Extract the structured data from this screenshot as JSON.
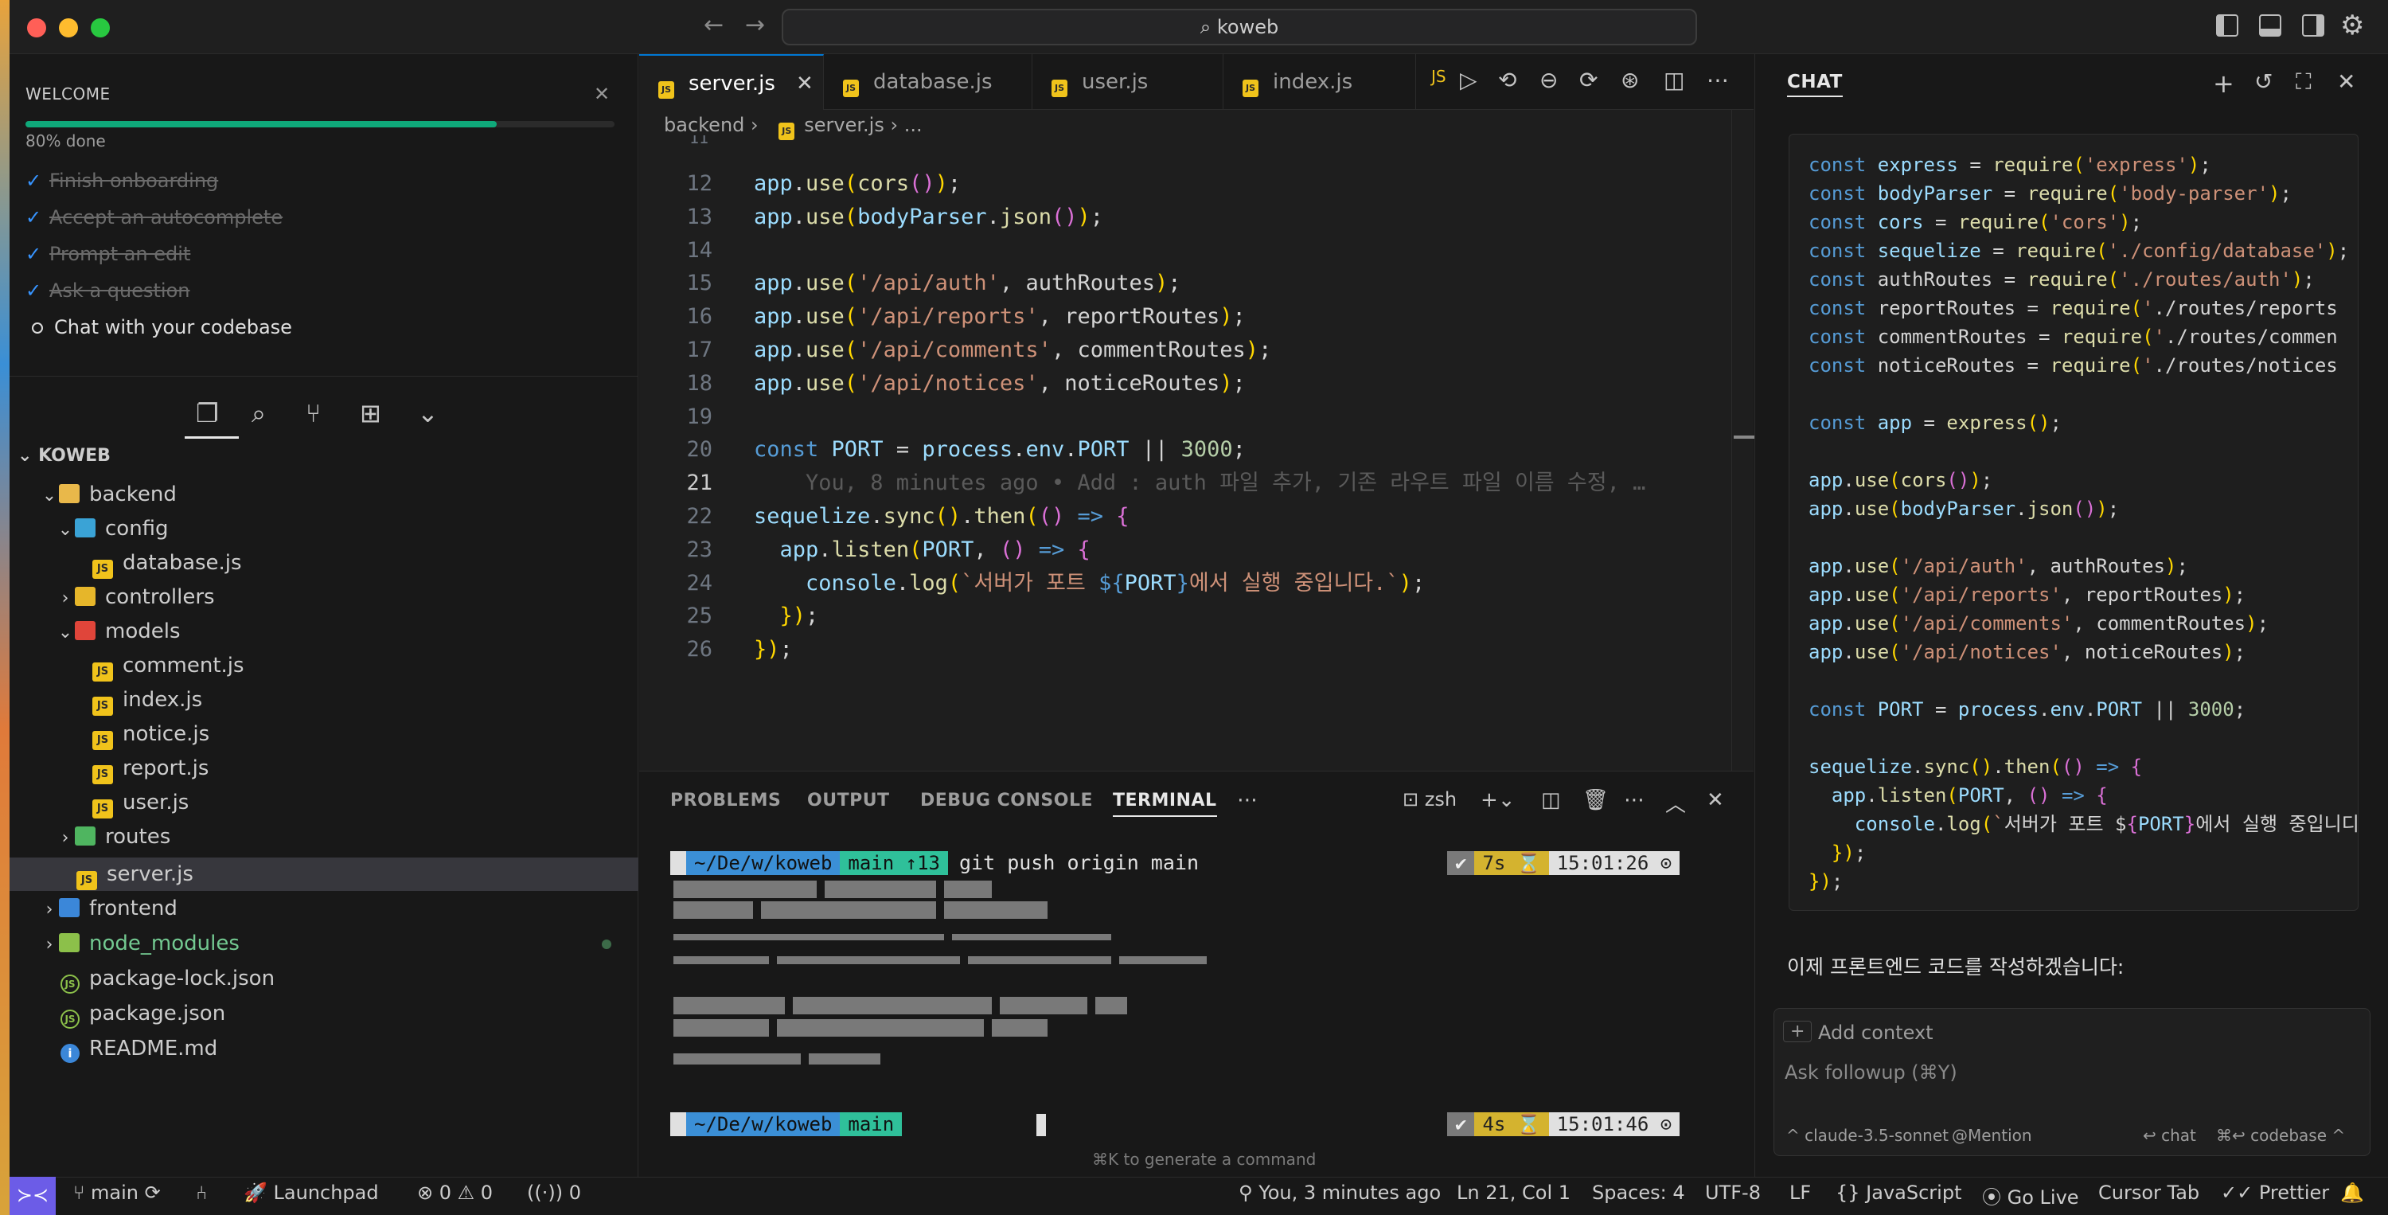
{
  "window": {
    "search_text": "koweb"
  },
  "onboarding": {
    "title": "WELCOME",
    "progress": 0.8,
    "progress_label": "80% done",
    "items": [
      {
        "label": "Finish onboarding",
        "done": true
      },
      {
        "label": "Accept an autocomplete",
        "done": true
      },
      {
        "label": "Prompt an edit",
        "done": true
      },
      {
        "label": "Ask a question",
        "done": true
      },
      {
        "label": "Chat with your codebase",
        "done": false
      }
    ]
  },
  "explorer": {
    "root": "KOWEB",
    "tree": [
      {
        "label": "backend",
        "type": "folder"
      },
      {
        "label": "config",
        "type": "folder"
      },
      {
        "label": "database.js",
        "type": "js"
      },
      {
        "label": "controllers",
        "type": "folder"
      },
      {
        "label": "models",
        "type": "folder"
      },
      {
        "label": "comment.js",
        "type": "js"
      },
      {
        "label": "index.js",
        "type": "js"
      },
      {
        "label": "notice.js",
        "type": "js"
      },
      {
        "label": "report.js",
        "type": "js"
      },
      {
        "label": "user.js",
        "type": "js"
      },
      {
        "label": "routes",
        "type": "folder"
      },
      {
        "label": "server.js",
        "type": "js",
        "selected": true
      },
      {
        "label": "frontend",
        "type": "folder"
      },
      {
        "label": "node_modules",
        "type": "folder"
      },
      {
        "label": "package-lock.json",
        "type": "json"
      },
      {
        "label": "package.json",
        "type": "json"
      },
      {
        "label": "README.md",
        "type": "info"
      }
    ]
  },
  "editor": {
    "tabs": [
      {
        "label": "server.js",
        "active": true
      },
      {
        "label": "database.js",
        "active": false
      },
      {
        "label": "user.js",
        "active": false
      },
      {
        "label": "index.js",
        "active": false
      }
    ],
    "breadcrumb": {
      "folder": "backend",
      "file": "server.js",
      "more": "..."
    },
    "top_line_stub": "11",
    "lines": [
      {
        "n": "12",
        "code": "app.use(cors());"
      },
      {
        "n": "13",
        "code": "app.use(bodyParser.json());"
      },
      {
        "n": "14",
        "code": ""
      },
      {
        "n": "15",
        "code": "app.use('/api/auth', authRoutes);"
      },
      {
        "n": "16",
        "code": "app.use('/api/reports', reportRoutes);"
      },
      {
        "n": "17",
        "code": "app.use('/api/comments', commentRoutes);"
      },
      {
        "n": "18",
        "code": "app.use('/api/notices', noticeRoutes);"
      },
      {
        "n": "19",
        "code": ""
      },
      {
        "n": "20",
        "code": "const PORT = process.env.PORT || 3000;"
      },
      {
        "n": "21",
        "code": "    You, 8 minutes ago • Add : auth 파일 추가, 기존 라우트 파일 이름 수정, …"
      },
      {
        "n": "22",
        "code": "sequelize.sync().then(() => {"
      },
      {
        "n": "23",
        "code": "  app.listen(PORT, () => {"
      },
      {
        "n": "24",
        "code": "    console.log(`서버가 포트 ${PORT}에서 실행 중입니다.`);"
      },
      {
        "n": "25",
        "code": "  });"
      },
      {
        "n": "26",
        "code": "});"
      }
    ]
  },
  "panel": {
    "tabs": [
      "PROBLEMS",
      "OUTPUT",
      "DEBUG CONSOLE",
      "TERMINAL"
    ],
    "active_tab": "TERMINAL",
    "shell": "zsh",
    "prompt1": {
      "path": "~/De/w/koweb",
      "branch": "main ↑13",
      "command": "git push origin main",
      "status": "✔",
      "duration": "7s ⌛",
      "time": "15:01:26 ⊙"
    },
    "prompt2": {
      "path": "~/De/w/koweb",
      "branch": "main",
      "status": "✔",
      "duration": "4s ⌛",
      "time": "15:01:46 ⊙"
    },
    "hint": "⌘K to generate a command"
  },
  "chat": {
    "title": "CHAT",
    "code": [
      "const express = require('express');",
      "const bodyParser = require('body-parser');",
      "const cors = require('cors');",
      "const sequelize = require('./config/database');",
      "const authRoutes = require('./routes/auth');",
      "const reportRoutes = require('./routes/reports",
      "const commentRoutes = require('./routes/commen",
      "const noticeRoutes = require('./routes/notices",
      "",
      "const app = express();",
      "",
      "app.use(cors());",
      "app.use(bodyParser.json());",
      "",
      "app.use('/api/auth', authRoutes);",
      "app.use('/api/reports', reportRoutes);",
      "app.use('/api/comments', commentRoutes);",
      "app.use('/api/notices', noticeRoutes);",
      "",
      "const PORT = process.env.PORT || 3000;",
      "",
      "sequelize.sync().then(() => {",
      "  app.listen(PORT, () => {",
      "    console.log(`서버가 포트 ${PORT}에서 실행 중입니디",
      "  });",
      "});"
    ],
    "message": "이제 프론트엔드 코드를 작성하겠습니다:",
    "add_context": "Add context",
    "input_placeholder": "Ask followup (⌘Y)",
    "model": "^ claude-3.5-sonnet",
    "mention": "@Mention",
    "chat_action": "↩ chat",
    "codebase_action": "⌘↩ codebase ^"
  },
  "statusbar": {
    "branch": "main",
    "launchpad": "Launchpad",
    "problems": "⊗ 0 ⚠ 0",
    "ports": "0",
    "blame": "You, 3 minutes ago",
    "position": "Ln 21, Col 1",
    "spaces": "Spaces: 4",
    "encoding": "UTF-8",
    "eol": "LF",
    "language": "JavaScript",
    "golive": "Go Live",
    "cursor_tab": "Cursor Tab",
    "prettier": "Prettier"
  }
}
